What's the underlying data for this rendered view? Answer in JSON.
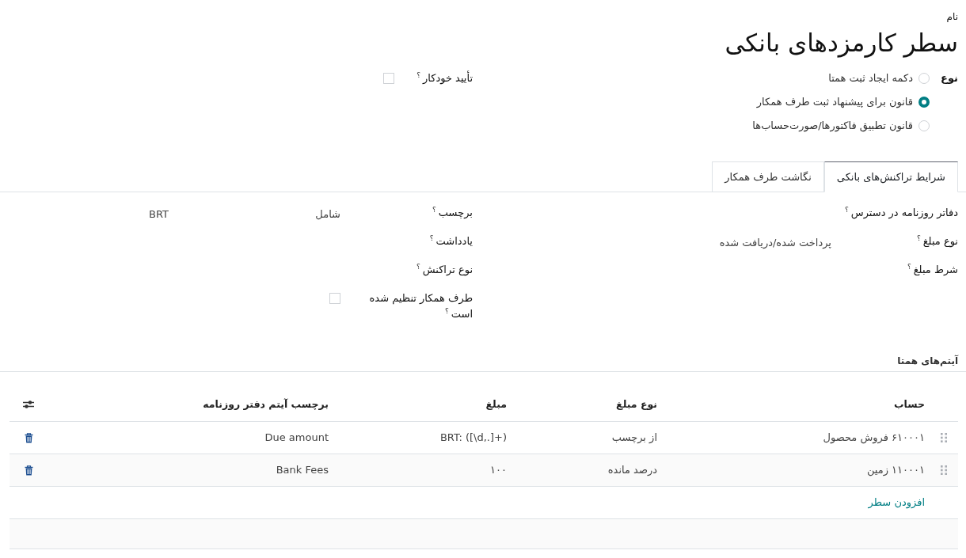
{
  "name_label": "نام",
  "title": "سطر کارمزدهای بانکی",
  "type_field": {
    "label": "نوع",
    "options": [
      {
        "label": "دکمه ایجاد ثبت همتا",
        "selected": false
      },
      {
        "label": "قانون برای پیشنهاد ثبت طرف همکار",
        "selected": true
      },
      {
        "label": "قانون تطبیق فاکتورها/صورت‌حساب‌ها",
        "selected": false
      }
    ]
  },
  "auto_validate": {
    "label": "تأیید خودکار",
    "help": "؟",
    "checked": false
  },
  "tabs": [
    {
      "label": "شرایط تراکنش‌های بانکی",
      "selected": true
    },
    {
      "label": "نگاشت طرف همکار",
      "selected": false
    }
  ],
  "conditions": {
    "right_fields": [
      {
        "kind": "text",
        "label": "دفاتر روزنامه در دسترس",
        "help": "؟"
      },
      {
        "kind": "text",
        "label": "نوع مبلغ",
        "help": "؟",
        "value": "پرداخت شده/دریافت شده"
      },
      {
        "kind": "text",
        "label": "شرط مبلغ",
        "help": "؟"
      }
    ],
    "left_fields": [
      {
        "kind": "match",
        "label": "برچسب",
        "help": "؟",
        "operator": "شامل",
        "value": "BRT"
      },
      {
        "kind": "text",
        "label": "یادداشت",
        "help": "؟"
      },
      {
        "kind": "text",
        "label": "نوع تراکنش",
        "help": "؟"
      },
      {
        "kind": "checkbox",
        "label": "طرف همکار تنظیم شده است",
        "help": "؟",
        "checked": false
      }
    ]
  },
  "counterpart_items": {
    "title": "آیتم‌های همتا",
    "columns": [
      "حساب",
      "نوع مبلغ",
      "مبلغ",
      "برچسب آیتم دفتر روزنامه"
    ],
    "rows": [
      {
        "account": "۶۱۰۰۰۱ فروش محصول",
        "amount_type": "از برچسب",
        "amount": "BRT: ([\\d,.]+)",
        "label": "Due amount"
      },
      {
        "account": "۱۱۰۰۰۱ زمین",
        "amount_type": "درصد مانده",
        "amount": "۱۰۰",
        "label": "Bank Fees"
      }
    ],
    "add_line": "افزودن سطر"
  }
}
